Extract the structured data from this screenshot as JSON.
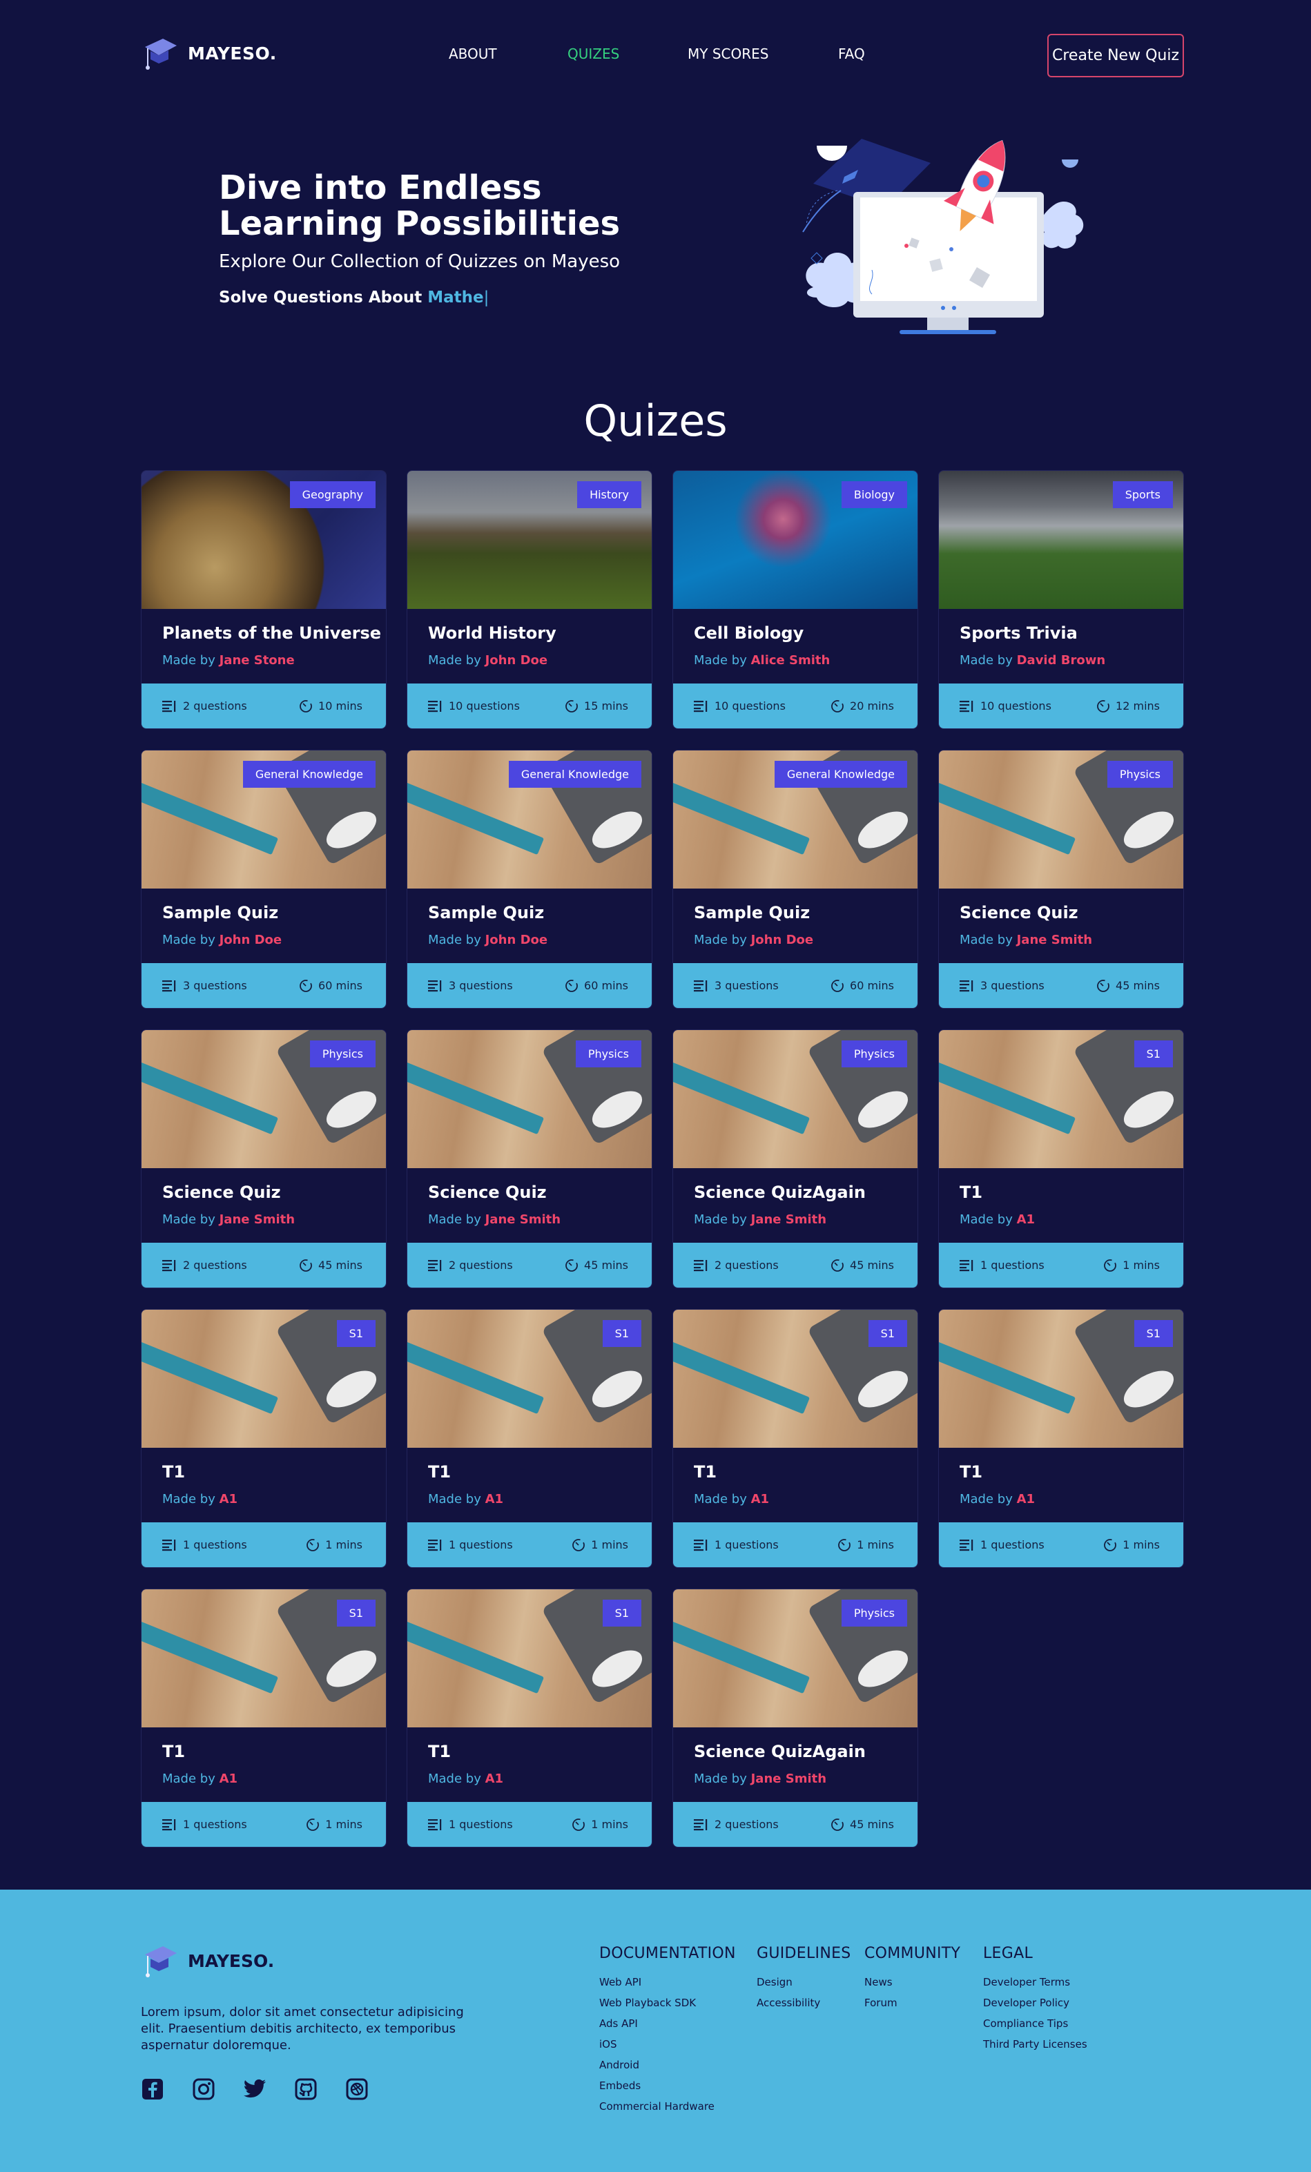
{
  "nav": {
    "brand": "MAYESO.",
    "links": [
      {
        "label": "ABOUT"
      },
      {
        "label": "QUIZES"
      },
      {
        "label": "MY SCORES"
      },
      {
        "label": "FAQ"
      }
    ],
    "active_link": "QUIZES",
    "create_button": "Create New Quiz"
  },
  "hero": {
    "title": "Dive into Endless Learning Possibilities",
    "subtitle": "Explore Our Collection of Quizzes on Mayeso",
    "solve_prefix": "Solve Questions About",
    "typed_text": "Mathe",
    "caret": "|"
  },
  "quizzes_section": {
    "title": "Quizes",
    "made_by_prefix": "Made by",
    "cards": [
      {
        "category": "Geography",
        "title": "Planets of the Universe",
        "author": "Jane Stone",
        "questions": "2 questions",
        "duration": "10 mins",
        "image": "globe"
      },
      {
        "category": "History",
        "title": "World History",
        "author": "John Doe",
        "questions": "10 questions",
        "duration": "15 mins",
        "image": "stonehenge"
      },
      {
        "category": "Biology",
        "title": "Cell Biology",
        "author": "Alice Smith",
        "questions": "10 questions",
        "duration": "20 mins",
        "image": "jellyfish"
      },
      {
        "category": "Sports",
        "title": "Sports Trivia",
        "author": "David Brown",
        "questions": "10 questions",
        "duration": "12 mins",
        "image": "stadium"
      },
      {
        "category": "General Knowledge",
        "title": "Sample Quiz",
        "author": "John Doe",
        "questions": "3 questions",
        "duration": "60 mins",
        "image": "pencil"
      },
      {
        "category": "General Knowledge",
        "title": "Sample Quiz",
        "author": "John Doe",
        "questions": "3 questions",
        "duration": "60 mins",
        "image": "pencil"
      },
      {
        "category": "General Knowledge",
        "title": "Sample Quiz",
        "author": "John Doe",
        "questions": "3 questions",
        "duration": "60 mins",
        "image": "pencil"
      },
      {
        "category": "Physics",
        "title": "Science Quiz",
        "author": "Jane Smith",
        "questions": "3 questions",
        "duration": "45 mins",
        "image": "pencil"
      },
      {
        "category": "Physics",
        "title": "Science Quiz",
        "author": "Jane Smith",
        "questions": "2 questions",
        "duration": "45 mins",
        "image": "pencil"
      },
      {
        "category": "Physics",
        "title": "Science Quiz",
        "author": "Jane Smith",
        "questions": "2 questions",
        "duration": "45 mins",
        "image": "pencil"
      },
      {
        "category": "Physics",
        "title": "Science QuizAgain",
        "author": "Jane Smith",
        "questions": "2 questions",
        "duration": "45 mins",
        "image": "pencil"
      },
      {
        "category": "S1",
        "title": "T1",
        "author": "A1",
        "questions": "1 questions",
        "duration": "1 mins",
        "image": "pencil"
      },
      {
        "category": "S1",
        "title": "T1",
        "author": "A1",
        "questions": "1 questions",
        "duration": "1 mins",
        "image": "pencil"
      },
      {
        "category": "S1",
        "title": "T1",
        "author": "A1",
        "questions": "1 questions",
        "duration": "1 mins",
        "image": "pencil"
      },
      {
        "category": "S1",
        "title": "T1",
        "author": "A1",
        "questions": "1 questions",
        "duration": "1 mins",
        "image": "pencil"
      },
      {
        "category": "S1",
        "title": "T1",
        "author": "A1",
        "questions": "1 questions",
        "duration": "1 mins",
        "image": "pencil"
      },
      {
        "category": "S1",
        "title": "T1",
        "author": "A1",
        "questions": "1 questions",
        "duration": "1 mins",
        "image": "pencil"
      },
      {
        "category": "S1",
        "title": "T1",
        "author": "A1",
        "questions": "1 questions",
        "duration": "1 mins",
        "image": "pencil"
      },
      {
        "category": "Physics",
        "title": "Science QuizAgain",
        "author": "Jane Smith",
        "questions": "2 questions",
        "duration": "45 mins",
        "image": "pencil"
      }
    ]
  },
  "footer": {
    "brand": "MAYESO.",
    "description": "Lorem ipsum, dolor sit amet consectetur adipisicing elit. Praesentium debitis architecto, ex temporibus aspernatur doloremque.",
    "socials": [
      "facebook-icon",
      "instagram-icon",
      "twitter-icon",
      "github-icon",
      "dribbble-icon"
    ],
    "columns": [
      {
        "heading": "DOCUMENTATION",
        "links": [
          "Web API",
          "Web Playback SDK",
          "Ads API",
          "iOS",
          "Android",
          "Embeds",
          "Commercial Hardware"
        ]
      },
      {
        "heading": "GUIDELINES",
        "links": [
          "Design",
          "Accessibility"
        ]
      },
      {
        "heading": "COMMUNITY",
        "links": [
          "News",
          "Forum"
        ]
      },
      {
        "heading": "LEGAL",
        "links": [
          "Developer Terms",
          "Developer Policy",
          "Compliance Tips",
          "Third Party Licenses"
        ]
      }
    ]
  },
  "colors": {
    "background": "#111240",
    "accent_green": "#35d07f",
    "accent_blue": "#4fb7e2",
    "author_red": "#f0466a",
    "badge": "#4c46e0",
    "create_border": "#d6456b"
  }
}
